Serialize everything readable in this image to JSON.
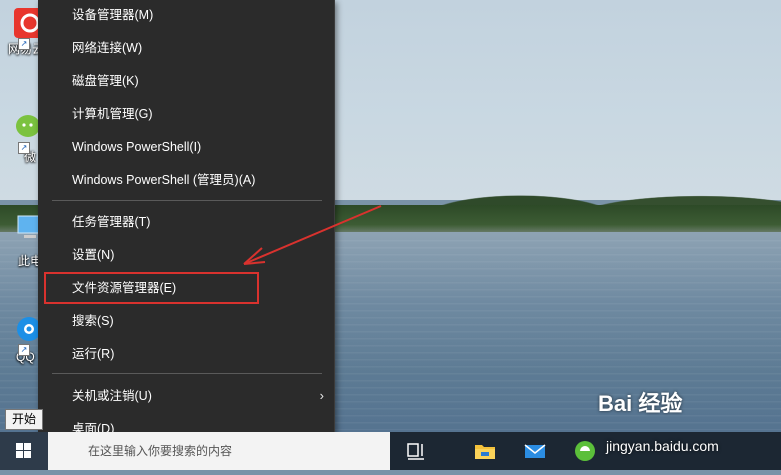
{
  "desktop": {
    "icons": [
      {
        "label": "网易云",
        "icon": "netease-cloud-music-icon"
      },
      {
        "label": "微",
        "icon": "wechat-icon"
      },
      {
        "label": "此电",
        "icon": "this-pc-icon"
      },
      {
        "label": "QQ",
        "icon": "qq-music-icon"
      }
    ]
  },
  "menu": {
    "items": [
      {
        "label": "设备管理器(M)"
      },
      {
        "label": "网络连接(W)"
      },
      {
        "label": "磁盘管理(K)"
      },
      {
        "label": "计算机管理(G)"
      },
      {
        "label": "Windows PowerShell(I)"
      },
      {
        "label": "Windows PowerShell (管理员)(A)"
      },
      {
        "label": "任务管理器(T)"
      },
      {
        "label": "设置(N)"
      },
      {
        "label": "文件资源管理器(E)"
      },
      {
        "label": "搜索(S)"
      },
      {
        "label": "运行(R)"
      },
      {
        "label": "关机或注销(U)"
      },
      {
        "label": "桌面(D)"
      }
    ],
    "highlighted_item": "文件资源管理器(E)",
    "submenu_arrow": "›"
  },
  "tooltip": {
    "text": "开始"
  },
  "taskbar": {
    "search_placeholder": "在这里输入你要搜索的内容",
    "icons": [
      "task-view-icon",
      "file-explorer-icon",
      "mail-icon",
      "browser-icon"
    ]
  },
  "watermark": {
    "logo_text": "Bai 经验",
    "url": "jingyan.baidu.com"
  },
  "colors": {
    "menu_bg": "#2b2b2b",
    "annotation_red": "#d9322e",
    "taskbar_bg": "#1c2733"
  }
}
